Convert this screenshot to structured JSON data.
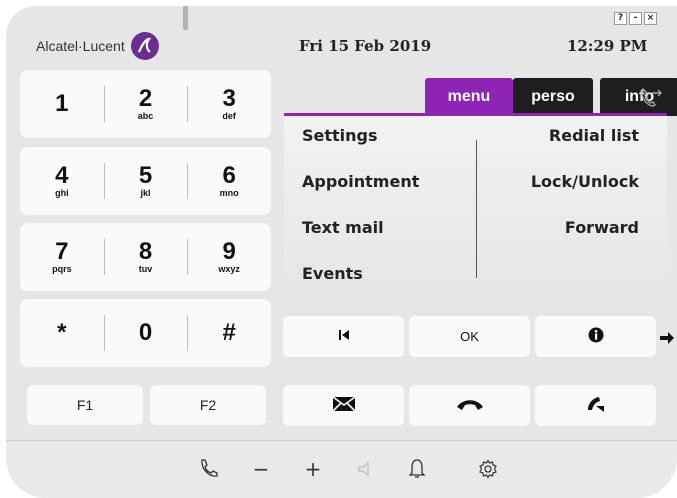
{
  "header": {
    "brand": "Alcatel·Lucent",
    "date": "Fri 15 Feb 2019",
    "time": "12:29  PM",
    "window_buttons": [
      "?",
      "-",
      "×"
    ]
  },
  "keypad": {
    "rows": [
      [
        {
          "num": "1",
          "letters": ""
        },
        {
          "num": "2",
          "letters": "abc"
        },
        {
          "num": "3",
          "letters": "def"
        }
      ],
      [
        {
          "num": "4",
          "letters": "ghi"
        },
        {
          "num": "5",
          "letters": "jkl"
        },
        {
          "num": "6",
          "letters": "mno"
        }
      ],
      [
        {
          "num": "7",
          "letters": "pqrs"
        },
        {
          "num": "8",
          "letters": "tuv"
        },
        {
          "num": "9",
          "letters": "wxyz"
        }
      ],
      [
        {
          "num": "*",
          "letters": ""
        },
        {
          "num": "0",
          "letters": ""
        },
        {
          "num": "#",
          "letters": ""
        }
      ]
    ],
    "f1": "F1",
    "f2": "F2"
  },
  "tabs": {
    "menu": "menu",
    "perso": "perso",
    "info": "info",
    "active": "menu"
  },
  "menu": {
    "left": [
      "Settings",
      "Appointment",
      "Text mail",
      "Events"
    ],
    "right": [
      "Redial list",
      "Lock/Unlock",
      "Forward"
    ]
  },
  "actions": {
    "ok": "OK"
  },
  "icons": {
    "nav": [
      "skip-back-icon",
      "info-icon",
      "arrow-right-icon"
    ],
    "call": [
      "mail-icon",
      "hangup-icon",
      "transfer-icon"
    ],
    "bottom": [
      "handsfree-icon",
      "minus-icon",
      "plus-icon",
      "mute-icon",
      "bell-icon",
      "gear-icon"
    ]
  },
  "bottom_bar": {
    "minus": "−",
    "plus": "+"
  },
  "colors": {
    "accent": "#8e24b5",
    "tab_dark": "#1e1e1e",
    "brand_logo": "#6a2d91"
  }
}
